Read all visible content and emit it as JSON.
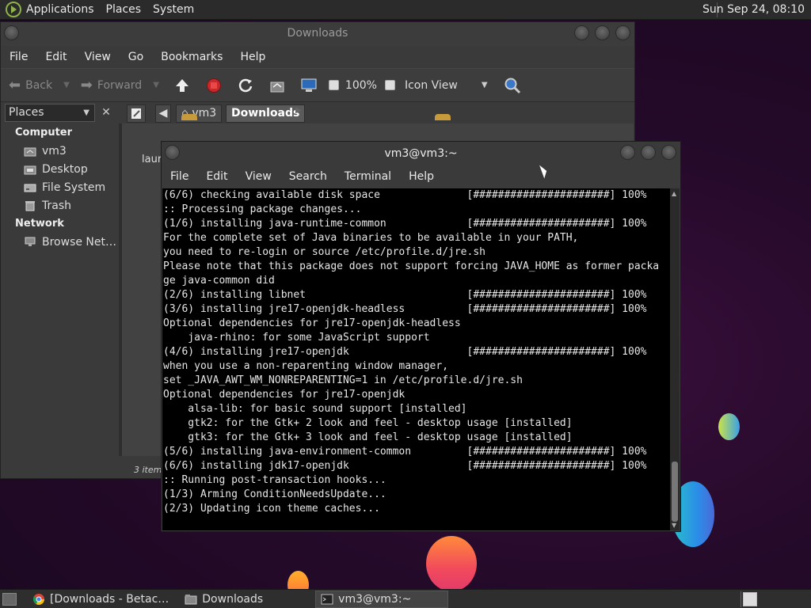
{
  "top_panel": {
    "menus": [
      "Applications",
      "Places",
      "System"
    ],
    "clock": "Sun Sep 24, 08:10"
  },
  "file_manager": {
    "title": "Downloads",
    "menus": [
      "File",
      "Edit",
      "View",
      "Go",
      "Bookmarks",
      "Help"
    ],
    "toolbar": {
      "back": "Back",
      "forward": "Forward",
      "zoom": "100%",
      "view_mode": "Icon View"
    },
    "places_label": "Places",
    "path": [
      "vm3",
      "Downloads"
    ],
    "sidebar": {
      "computer_heading": "Computer",
      "computer_items": [
        "vm3",
        "Desktop",
        "File System",
        "Trash"
      ],
      "network_heading": "Network",
      "network_items": [
        "Browse Net…"
      ]
    },
    "partial_file_label": "laur",
    "status": "3 items"
  },
  "terminal": {
    "title": "vm3@vm3:~",
    "menus": [
      "File",
      "Edit",
      "View",
      "Search",
      "Terminal",
      "Help"
    ],
    "lines": [
      "(6/6) checking available disk space              [######################] 100%",
      ":: Processing package changes...",
      "(1/6) installing java-runtime-common             [######################] 100%",
      "For the complete set of Java binaries to be available in your PATH,",
      "you need to re-login or source /etc/profile.d/jre.sh",
      "Please note that this package does not support forcing JAVA_HOME as former packa",
      "ge java-common did",
      "(2/6) installing libnet                          [######################] 100%",
      "(3/6) installing jre17-openjdk-headless          [######################] 100%",
      "Optional dependencies for jre17-openjdk-headless",
      "    java-rhino: for some JavaScript support",
      "(4/6) installing jre17-openjdk                   [######################] 100%",
      "when you use a non-reparenting window manager,",
      "set _JAVA_AWT_WM_NONREPARENTING=1 in /etc/profile.d/jre.sh",
      "Optional dependencies for jre17-openjdk",
      "    alsa-lib: for basic sound support [installed]",
      "    gtk2: for the Gtk+ 2 look and feel - desktop usage [installed]",
      "    gtk3: for the Gtk+ 3 look and feel - desktop usage [installed]",
      "(5/6) installing java-environment-common         [######################] 100%",
      "(6/6) installing jdk17-openjdk                   [######################] 100%",
      ":: Running post-transaction hooks...",
      "(1/3) Arming ConditionNeedsUpdate...",
      "(2/3) Updating icon theme caches..."
    ]
  },
  "taskbar": {
    "tasks": [
      "[Downloads - Betac…",
      "Downloads",
      "vm3@vm3:~"
    ]
  }
}
